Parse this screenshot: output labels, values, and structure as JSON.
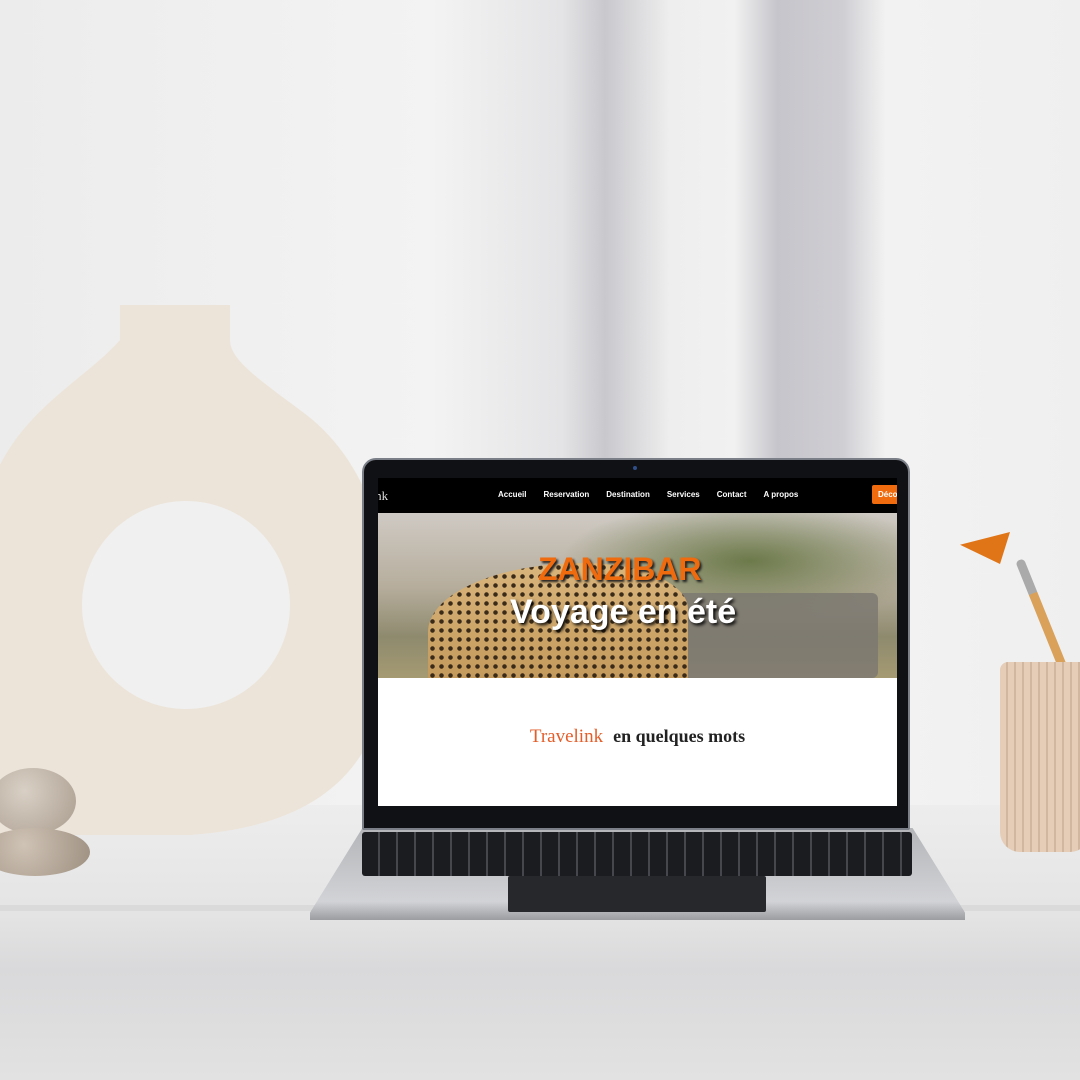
{
  "website": {
    "logo": "Travelink",
    "nav": [
      "Accueil",
      "Reservation",
      "Destination",
      "Services",
      "Contact",
      "A propos"
    ],
    "cta_label": "Découvrir",
    "hero": {
      "title": "ZANZIBAR",
      "subtitle": "Voyage en été"
    },
    "about": {
      "brand": "Travelink",
      "heading": "en quelques mots"
    }
  },
  "colors": {
    "accent": "#f06a0e",
    "nav_bg": "#000000"
  }
}
